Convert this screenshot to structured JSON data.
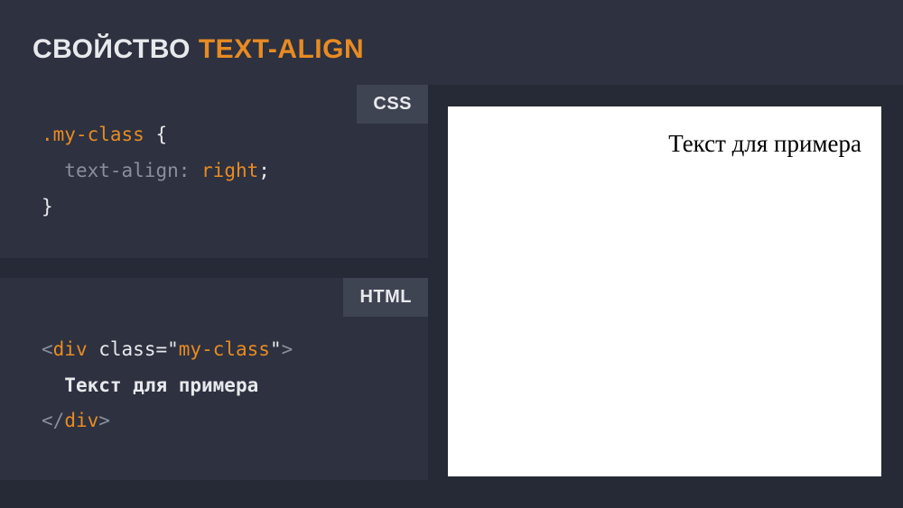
{
  "header": {
    "title_part1": "СВОЙСТВО ",
    "title_part2": "TEXT-ALIGN"
  },
  "labels": {
    "css": "CSS",
    "html": "HTML"
  },
  "css_code": {
    "selector": ".my-class",
    "open": " {",
    "indent": "  ",
    "property": "text-align",
    "colon": ": ",
    "value": "right",
    "semi": ";",
    "close": "}"
  },
  "html_code": {
    "lt": "<",
    "gt": ">",
    "slash": "/",
    "tag": "div",
    "attr_name": "class",
    "eq": "=",
    "quote": "\"",
    "attr_value": "my-class",
    "indent": "  ",
    "inner_text": "Текст для примера"
  },
  "preview": {
    "text": "Текст для примера",
    "text_align": "right"
  }
}
